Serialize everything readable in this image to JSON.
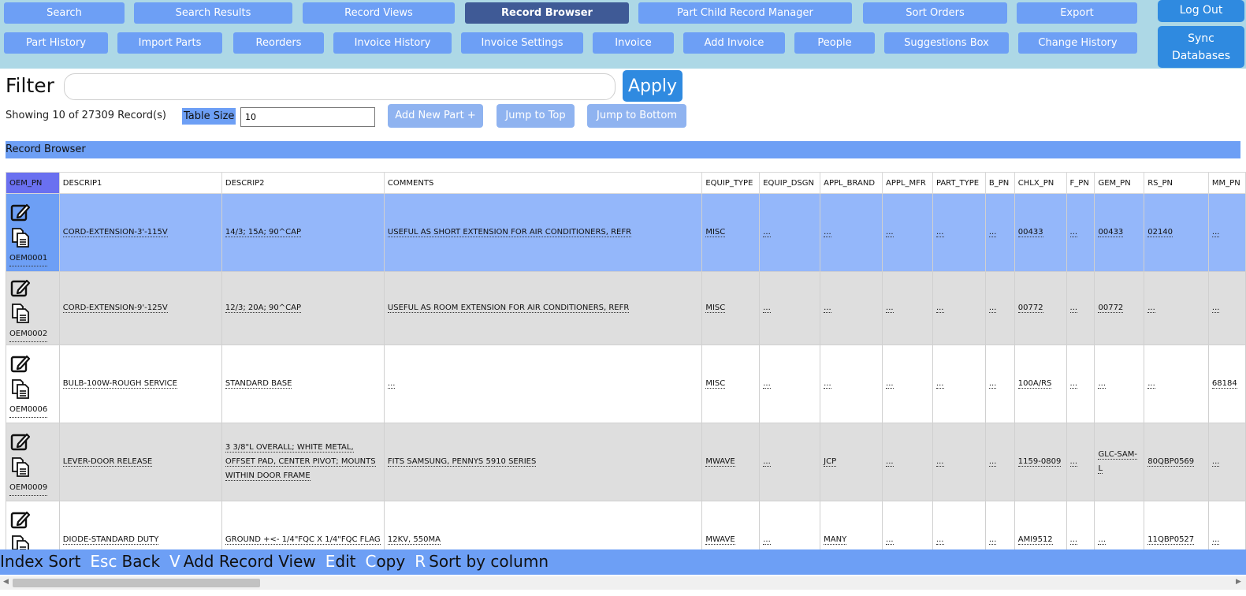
{
  "nav": {
    "row1": [
      "Search",
      "Search Results",
      "Record Views",
      "Record Browser",
      "Part Child Record Manager",
      "Sort Orders",
      "Export"
    ],
    "row2": [
      "Part History",
      "Import Parts",
      "Reorders",
      "Invoice History",
      "Invoice Settings",
      "Invoice",
      "Add Invoice",
      "People",
      "Suggestions Box",
      "Change History"
    ],
    "active": "Record Browser",
    "logout": "Log Out",
    "sync_line1": "Sync",
    "sync_line2": "Databases"
  },
  "filter": {
    "label": "Filter",
    "value": "",
    "apply": "Apply"
  },
  "status": {
    "showing": "Showing 10 of 27309 Record(s)",
    "table_size_label": "Table Size",
    "table_size_value": "10"
  },
  "actions": {
    "add_new": "Add New Part +",
    "jump_top": "Jump to Top",
    "jump_bottom": "Jump to Bottom"
  },
  "section_title": "Record Browser",
  "table": {
    "columns": [
      "OEM_PN",
      "DESCRIP1",
      "DESCRIP2",
      "COMMENTS",
      "EQUIP_TYPE",
      "EQUIP_DSGN",
      "APPL_BRAND",
      "APPL_MFR",
      "PART_TYPE",
      "B_PN",
      "CHLX_PN",
      "F_PN",
      "GEM_PN",
      "RS_PN",
      "MM_PN"
    ],
    "rows": [
      [
        "OEM0001",
        "CORD-EXTENSION-3'-115V",
        "14/3; 15A; 90^CAP",
        "USEFUL AS SHORT EXTENSION FOR AIR CONDITIONERS, REFR",
        "MISC",
        "...",
        "...",
        "...",
        "...",
        "...",
        "00433",
        "...",
        "00433",
        "02140",
        "..."
      ],
      [
        "OEM0002",
        "CORD-EXTENSION-9'-125V",
        "12/3; 20A; 90^CAP",
        "USEFUL AS ROOM EXTENSION FOR AIR CONDITIONERS, REFR",
        "MISC",
        "...",
        "...",
        "...",
        "...",
        "...",
        "00772",
        "...",
        "00772",
        "...",
        "..."
      ],
      [
        "OEM0006",
        "BULB-100W-ROUGH SERVICE",
        "STANDARD BASE",
        "...",
        "MISC",
        "...",
        "...",
        "...",
        "...",
        "...",
        "100A/RS",
        "...",
        "...",
        "...",
        "68184"
      ],
      [
        "OEM0009",
        "LEVER-DOOR RELEASE",
        "3 3/8\"L OVERALL; WHITE METAL, OFFSET PAD, CENTER PIVOT; MOUNTS WITHIN DOOR FRAME",
        "FITS SAMSUNG, PENNYS 5910 SERIES",
        "MWAVE",
        "...",
        "JCP",
        "...",
        "...",
        "...",
        "1159-0809",
        "...",
        "GLC-SAM-L",
        "80QBP0569",
        "..."
      ],
      [
        "",
        "DIODE-STANDARD DUTY",
        "GROUND +<- 1/4\"FQC X 1/4\"FQC FLAG",
        "12KV, 550MA",
        "MWAVE",
        "...",
        "MANY",
        "...",
        "...",
        "...",
        "AMI9512",
        "...",
        "...",
        "11QBP0527",
        "..."
      ]
    ]
  },
  "shortcuts": [
    {
      "key": "",
      "label": "Index Sort"
    },
    {
      "key": "Esc",
      "label": "Back"
    },
    {
      "key": "V",
      "label": "Add Record View"
    },
    {
      "key": "E",
      "label": "dit"
    },
    {
      "key": "C",
      "label": "opy"
    },
    {
      "key": "R",
      "label": "Sort by column"
    }
  ],
  "colors": {
    "accent": "#6d9ff5",
    "active_nav": "#3f5a96",
    "apply": "#2f8ae0",
    "selected_row": "#94b7fa",
    "nav_bg": "#add8e6"
  }
}
